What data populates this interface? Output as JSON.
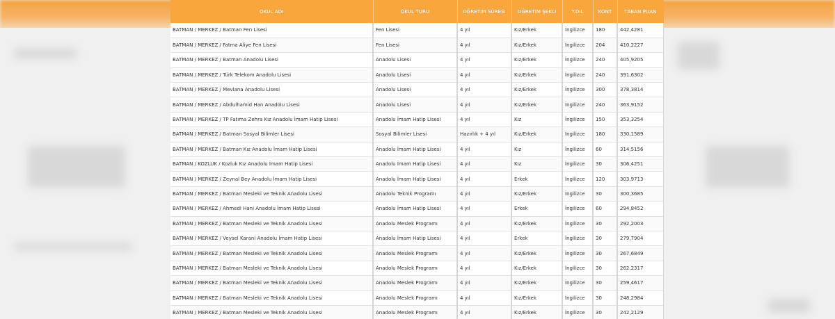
{
  "table": {
    "headers": [
      "OKUL ADI",
      "OKUL TURU",
      "OĞRETIM SÜRESI",
      "OĞRETIM ŞEKLI",
      "Y.DIL",
      "KONT",
      "TABAN PUAN"
    ],
    "rows": [
      [
        "BATMAN / MERKEZ / Batman Fen Lisesi",
        "Fen Lisesi",
        "4 yıl",
        "Kız/Erkek",
        "İngilizce",
        "180",
        "442,4281"
      ],
      [
        "BATMAN / MERKEZ / Fatma Aliye Fen Lisesi",
        "Fen Lisesi",
        "4 yıl",
        "Kız/Erkek",
        "İngilizce",
        "204",
        "410,2227"
      ],
      [
        "BATMAN / MERKEZ / Batman Anadolu Lisesi",
        "Anadolu Lisesi",
        "4 yıl",
        "Kız/Erkek",
        "İngilizce",
        "240",
        "405,9205"
      ],
      [
        "BATMAN / MERKEZ / Türk Telekom Anadolu Lisesi",
        "Anadolu Lisesi",
        "4 yıl",
        "Kız/Erkek",
        "İngilizce",
        "240",
        "391,6302"
      ],
      [
        "BATMAN / MERKEZ / Mevlana Anadolu Lisesi",
        "Anadolu Lisesi",
        "4 yıl",
        "Kız/Erkek",
        "İngilizce",
        "300",
        "378,3814"
      ],
      [
        "BATMAN / MERKEZ / Abdulhamid Han Anadolu Lisesi",
        "Anadolu Lisesi",
        "4 yıl",
        "Kız/Erkek",
        "İngilizce",
        "240",
        "363,9152"
      ],
      [
        "BATMAN / MERKEZ / TP Fatıma Zehra Kız Anadolu İmam Hatip Lisesi",
        "Anadolu İmam Hatip Lisesi",
        "4 yıl",
        "Kız",
        "İngilizce",
        "150",
        "353,3254"
      ],
      [
        "BATMAN / MERKEZ / Batman Sosyal Bilimler Lisesi",
        "Sosyal Bilimler Lisesi",
        "Hazırlık + 4 yıl",
        "Kız/Erkek",
        "İngilizce",
        "180",
        "330,1589"
      ],
      [
        "BATMAN / MERKEZ / Batman Kız Anadolu İmam Hatip Lisesi",
        "Anadolu İmam Hatip Lisesi",
        "4 yıl",
        "Kız",
        "İngilizce",
        "60",
        "314,5156"
      ],
      [
        "BATMAN / KOZLUK / Kozluk Kız Anadolu İmam Hatip Lisesi",
        "Anadolu İmam Hatip Lisesi",
        "4 yıl",
        "Kız",
        "İngilizce",
        "30",
        "306,4251"
      ],
      [
        "BATMAN / MERKEZ / Zeynal Bey Anadolu İmam Hatip Lisesi",
        "Anadolu İmam Hatip Lisesi",
        "4 yıl",
        "Erkek",
        "İngilizce",
        "120",
        "303,9713"
      ],
      [
        "BATMAN / MERKEZ / Batman Mesleki ve Teknik Anadolu Lisesi",
        "Anadolu Teknik Programı",
        "4 yıl",
        "Kız/Erkek",
        "İngilizce",
        "30",
        "300,3685"
      ],
      [
        "BATMAN / MERKEZ / Ahmedi Hani Anadolu İmam Hatip Lisesi",
        "Anadolu İmam Hatip Lisesi",
        "4 yıl",
        "Erkek",
        "İngilizce",
        "60",
        "294,8452"
      ],
      [
        "BATMAN / MERKEZ / Batman Mesleki ve Teknik Anadolu Lisesi",
        "Anadolu Meslek Programı",
        "4 yıl",
        "Kız/Erkek",
        "İngilizce",
        "30",
        "292,2003"
      ],
      [
        "BATMAN / MERKEZ / Veysel Karani Anadolu İmam Hatip Lisesi",
        "Anadolu İmam Hatip Lisesi",
        "4 yıl",
        "Erkek",
        "İngilizce",
        "30",
        "279,7904"
      ],
      [
        "BATMAN / MERKEZ / Batman Mesleki ve Teknik Anadolu Lisesi",
        "Anadolu Meslek Programı",
        "4 yıl",
        "Kız/Erkek",
        "İngilizce",
        "30",
        "267,6849"
      ],
      [
        "BATMAN / MERKEZ / Batman Mesleki ve Teknik Anadolu Lisesi",
        "Anadolu Meslek Programı",
        "4 yıl",
        "Kız/Erkek",
        "İngilizce",
        "30",
        "262,2317"
      ],
      [
        "BATMAN / MERKEZ / Batman Mesleki ve Teknik Anadolu Lisesi",
        "Anadolu Meslek Programı",
        "4 yıl",
        "Kız/Erkek",
        "İngilizce",
        "30",
        "259,4617"
      ],
      [
        "BATMAN / MERKEZ / Batman Mesleki ve Teknik Anadolu Lisesi",
        "Anadolu Meslek Programı",
        "4 yıl",
        "Kız/Erkek",
        "İngilizce",
        "30",
        "248,2984"
      ],
      [
        "BATMAN / MERKEZ / Batman Mesleki ve Teknik Anadolu Lisesi",
        "Anadolu Meslek Programı",
        "4 yıl",
        "Kız/Erkek",
        "İngilizce",
        "30",
        "242,2129"
      ]
    ]
  },
  "colors": {
    "header_bg": "#f9a63d",
    "header_text": "#ffffff",
    "cell_text": "#333333"
  }
}
